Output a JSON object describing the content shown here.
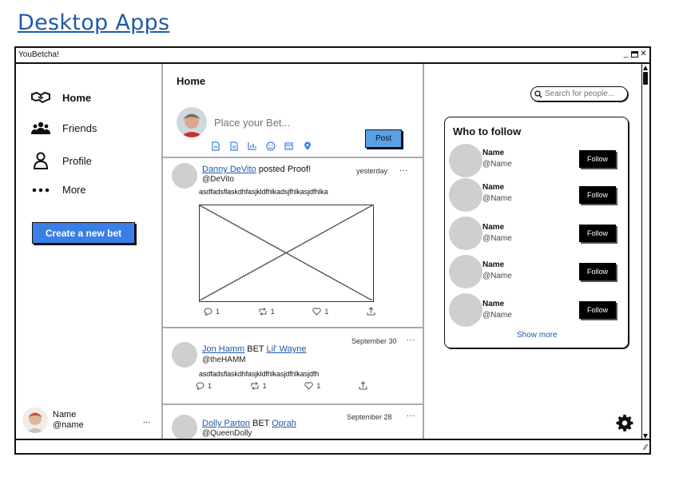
{
  "page": {
    "heading": "Desktop Apps"
  },
  "window": {
    "title": "YouBetcha!",
    "controls": [
      "minimize",
      "maximize",
      "close"
    ]
  },
  "sidebar": {
    "items": [
      {
        "label": "Home",
        "icon": "handshake-icon",
        "active": true
      },
      {
        "label": "Friends",
        "icon": "people-icon",
        "active": false
      },
      {
        "label": "Profile",
        "icon": "person-icon",
        "active": false
      },
      {
        "label": "More",
        "icon": "ellipsis-icon",
        "active": false
      }
    ],
    "create_label": "Create a new bet",
    "user": {
      "name": "Name",
      "handle": "@name",
      "more": "..."
    }
  },
  "feed": {
    "title": "Home",
    "compose": {
      "placeholder": "Place your Bet...",
      "post_label": "Post",
      "tools": [
        "image-icon",
        "file-icon",
        "chart-icon",
        "emoji-icon",
        "calendar-icon",
        "location-icon"
      ]
    },
    "posts": [
      {
        "author": "Danny DeVito",
        "verb": "posted Proof!",
        "target": "",
        "handle": "@DeVito",
        "date": "yesterday",
        "text": "asdfadsflaskdhfasjkldfhlkadsjfhlkasjdfhlka",
        "has_image": true,
        "replies": "1",
        "reposts": "1",
        "likes": "1"
      },
      {
        "author": "Jon Hamm",
        "verb": "BET",
        "target": "Lil' Wayne",
        "handle": "@theHAMM",
        "date": "September 30",
        "text": "asdfadsflaskdhfasjkldfhlkasjdfhlkasjdfh",
        "has_image": false,
        "replies": "1",
        "reposts": "1",
        "likes": "1"
      },
      {
        "author": "Dolly Parton",
        "verb": "BET",
        "target": "Oprah",
        "handle": "@QueenDolly",
        "date": "September 28",
        "text": "",
        "has_image": false
      }
    ],
    "more": "..."
  },
  "right": {
    "search_placeholder": "Search for people...",
    "who_to_follow": {
      "title": "Who to follow",
      "people": [
        {
          "name": "Name",
          "handle": "@Name",
          "button": "Follow"
        },
        {
          "name": "Name",
          "handle": "@Name",
          "button": "Follow"
        },
        {
          "name": "Name",
          "handle": "@Name",
          "button": "Follow"
        },
        {
          "name": "Name",
          "handle": "@Name",
          "button": "Follow"
        },
        {
          "name": "Name",
          "handle": "@Name",
          "button": "Follow"
        }
      ],
      "show_more": "Show more"
    }
  }
}
